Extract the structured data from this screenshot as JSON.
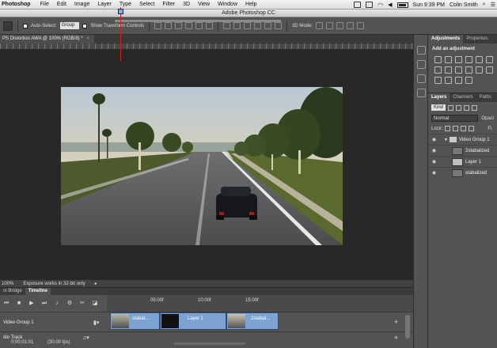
{
  "menubar": {
    "app": "Photoshop",
    "items": [
      "File",
      "Edit",
      "Image",
      "Layer",
      "Type",
      "Select",
      "Filter",
      "3D",
      "View",
      "Window",
      "Help"
    ],
    "clock": "Sun 9:39 PM",
    "user": "Colin Smith"
  },
  "window": {
    "title": "Adobe Photoshop CC"
  },
  "options": {
    "auto_select_label": "Auto-Select:",
    "auto_select_value": "Group",
    "show_transform_label": "Show Transform Controls",
    "mode_3d_label": "3D Mode:"
  },
  "document": {
    "tab_label": "PS Distortion AWA @ 100% (RGB/8) *",
    "close": "×"
  },
  "status": {
    "zoom": "100%",
    "message": "Exposure works in 32-bit only"
  },
  "panels": {
    "tabs": [
      "Adjustments",
      "Properties"
    ],
    "add_adjustment": "Add an adjustment",
    "layer_tabs": [
      "Layers",
      "Channels",
      "Paths"
    ],
    "filter_kind": "Kind",
    "blend_mode": "Normal",
    "opacity_label": "Opaci",
    "lock_label": "Lock:",
    "fill_label": "Fi",
    "layers": [
      {
        "name": "Video Group 1",
        "type": "group"
      },
      {
        "name": "2stabalized",
        "type": "layer"
      },
      {
        "name": "Layer 1",
        "type": "layer"
      },
      {
        "name": "stabalized",
        "type": "layer"
      }
    ]
  },
  "bottom": {
    "tabs": [
      "ni Bridge",
      "Timeline"
    ],
    "ticks": [
      "05:00f",
      "10:00f",
      "15:00f"
    ],
    "tracks": {
      "video": "Video Group 1",
      "audio": "dio Track"
    },
    "clips": [
      "stabal...",
      "Layer 1",
      "2stabal..."
    ],
    "timecode": "0;00;01;01",
    "fps": "(30.00 fps)"
  },
  "colors": {
    "panel": "#535353",
    "clip": "#7da3d3",
    "playhead": "#d02020"
  }
}
